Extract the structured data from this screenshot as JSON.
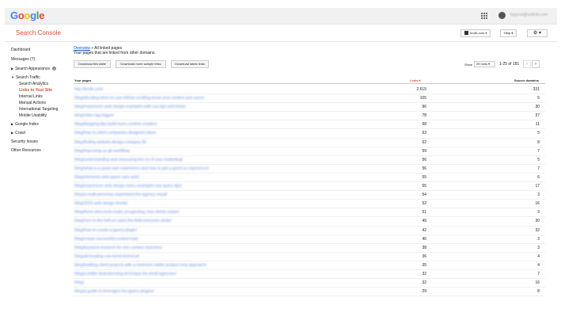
{
  "header": {
    "logo_letters": [
      "G",
      "o",
      "o",
      "g",
      "l",
      "e"
    ],
    "apps_icon": "apps-grid-icon",
    "account_email": "tipgood@widicbl.com"
  },
  "subheader": {
    "product_name": "Search Console",
    "site_label": "brolik.com",
    "help_label": "Help",
    "settings_icon": "gear-icon"
  },
  "sidebar": {
    "dashboard": "Dashboard",
    "messages": "Messages (7)",
    "search_appearance": "Search Appearance",
    "search_traffic": "Search Traffic",
    "search_analytics": "Search Analytics",
    "links_to_your_site": "Links to Your Site",
    "internal_links": "Internal Links",
    "manual_actions": "Manual Actions",
    "international_targeting": "International Targeting",
    "mobile_usability": "Mobile Usability",
    "google_index": "Google Index",
    "crawl": "Crawl",
    "security_issues": "Security Issues",
    "other_resources": "Other Resources"
  },
  "main": {
    "breadcrumb_link": "Overview",
    "breadcrumb_sep": " » ",
    "breadcrumb_current": "All linked pages",
    "subtitle": "Your pages that are linked from other domains.",
    "download_table": "Download this table",
    "download_more": "Download more sample links",
    "download_latest": "Download latest links",
    "show_label": "Show",
    "rows_select": "25 rows",
    "range_text": "1-25 of 181",
    "col_pages": "Your pages",
    "col_links": "Links ▾",
    "col_domains": "Source domains",
    "rows": [
      {
        "url": "http://brolik.com/",
        "links": "2,615",
        "domains": "331"
      },
      {
        "url": "/blog/deciding-when-to-use-infinite-scrolling-know-your-content-and-users/",
        "links": "105",
        "domains": "5"
      },
      {
        "url": "/blog/responsive-web-design-examples-with-css-tips-and-tricks/",
        "links": "96",
        "domains": "30"
      },
      {
        "url": "/blog/video-tag-trigger/",
        "links": "78",
        "domains": "37"
      },
      {
        "url": "/blog/blogging-tips-build-team-content-creation/",
        "links": "68",
        "domains": "11"
      },
      {
        "url": "/blog/how-to-client-companies-designed-value/",
        "links": "63",
        "domains": "5"
      },
      {
        "url": "/blog/finding-website-design-company-fit/",
        "links": "62",
        "domains": "8"
      },
      {
        "url": "/blog/improving-ux-git-workflow/",
        "links": "59",
        "domains": "7"
      },
      {
        "url": "/blog/understanding-and-measuring-the-roi-of-your-marketing/",
        "links": "56",
        "domains": "5"
      },
      {
        "url": "/blog/what-is-a-good-user-experience-and-how-to-get-a-good-ux-experience/",
        "links": "56",
        "domains": "7"
      },
      {
        "url": "/blog/elements-web-space-user-web/",
        "links": "55",
        "domains": "6"
      },
      {
        "url": "/blog/responsive-web-design-menu-examples-nav-query-tips/",
        "links": "55",
        "domains": "17"
      },
      {
        "url": "/blog/a-multi-personas-experiment-the-agency-result/",
        "links": "54",
        "domains": "3"
      },
      {
        "url": "/blog/2015-web-design-trends/",
        "links": "52",
        "domains": "16"
      },
      {
        "url": "/blog/three-sites-tools-make-prospecting-new-clients-easier/",
        "links": "51",
        "domains": "3"
      },
      {
        "url": "/blog/nice-to-the-hell-on-sales-the-field-everyone-wrote/",
        "links": "49",
        "domains": "30"
      },
      {
        "url": "/blog/how-to-create-a-jquery-plugin/",
        "links": "42",
        "domains": "32"
      },
      {
        "url": "/blog/create-successful-content-hub/",
        "links": "40",
        "domains": "3"
      },
      {
        "url": "/blog/keyword-research-for-non-content-searches/",
        "links": "38",
        "domains": "3"
      },
      {
        "url": "/blog/all-heading-can-bond-technical/",
        "links": "36",
        "domains": "4"
      },
      {
        "url": "/blog/building-client-projects-with-a-minimum-viable-product-mvp-approach/",
        "links": "35",
        "domains": "4"
      },
      {
        "url": "/blog/a-better-brainstorming-technique-for-small-agencies/",
        "links": "32",
        "domains": "7"
      },
      {
        "url": "/blog/",
        "links": "32",
        "domains": "16"
      },
      {
        "url": "/blog/a-guide-to-leverages-the-jquery-plugins/",
        "links": "29",
        "domains": "8"
      }
    ]
  }
}
